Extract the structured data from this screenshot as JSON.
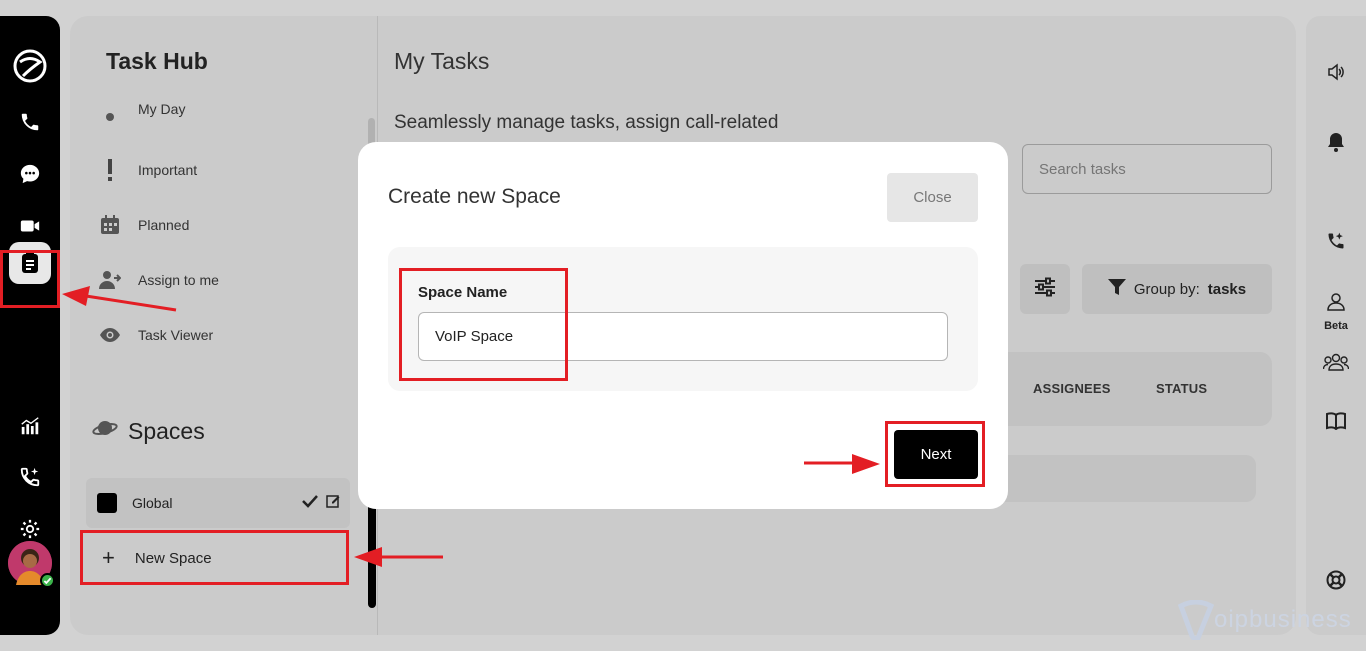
{
  "sidebar": {
    "items": [
      "phone",
      "chat",
      "video",
      "tasks",
      "analytics",
      "call-ai",
      "settings"
    ]
  },
  "task_hub": {
    "title": "Task Hub",
    "nav": [
      {
        "label": "My Day",
        "icon": "sun-icon"
      },
      {
        "label": "Important",
        "icon": "exclamation-icon"
      },
      {
        "label": "Planned",
        "icon": "calendar-icon"
      },
      {
        "label": "Assign to me",
        "icon": "user-assign-icon"
      },
      {
        "label": "Task Viewer",
        "icon": "eye-icon"
      }
    ],
    "spaces_title": "Spaces",
    "spaces": [
      {
        "name": "Global",
        "color": "#000000"
      }
    ],
    "new_space_label": "New Space"
  },
  "content": {
    "title": "My Tasks",
    "description": "Seamlessly manage tasks, assign call-related",
    "search_placeholder": "Search tasks",
    "group_by_prefix": "Group by:",
    "group_by_value": "tasks",
    "columns": {
      "assignees": "ASSIGNEES",
      "status": "STATUS"
    }
  },
  "right_rail": {
    "beta_label": "Beta"
  },
  "modal": {
    "title": "Create new Space",
    "close_label": "Close",
    "field_label": "Space Name",
    "field_value": "VoIP Space",
    "next_label": "Next"
  },
  "watermark": {
    "text": "oipbusiness"
  },
  "colors": {
    "highlight": "#e31e24",
    "primary": "#000000",
    "online": "#3bb34a"
  }
}
